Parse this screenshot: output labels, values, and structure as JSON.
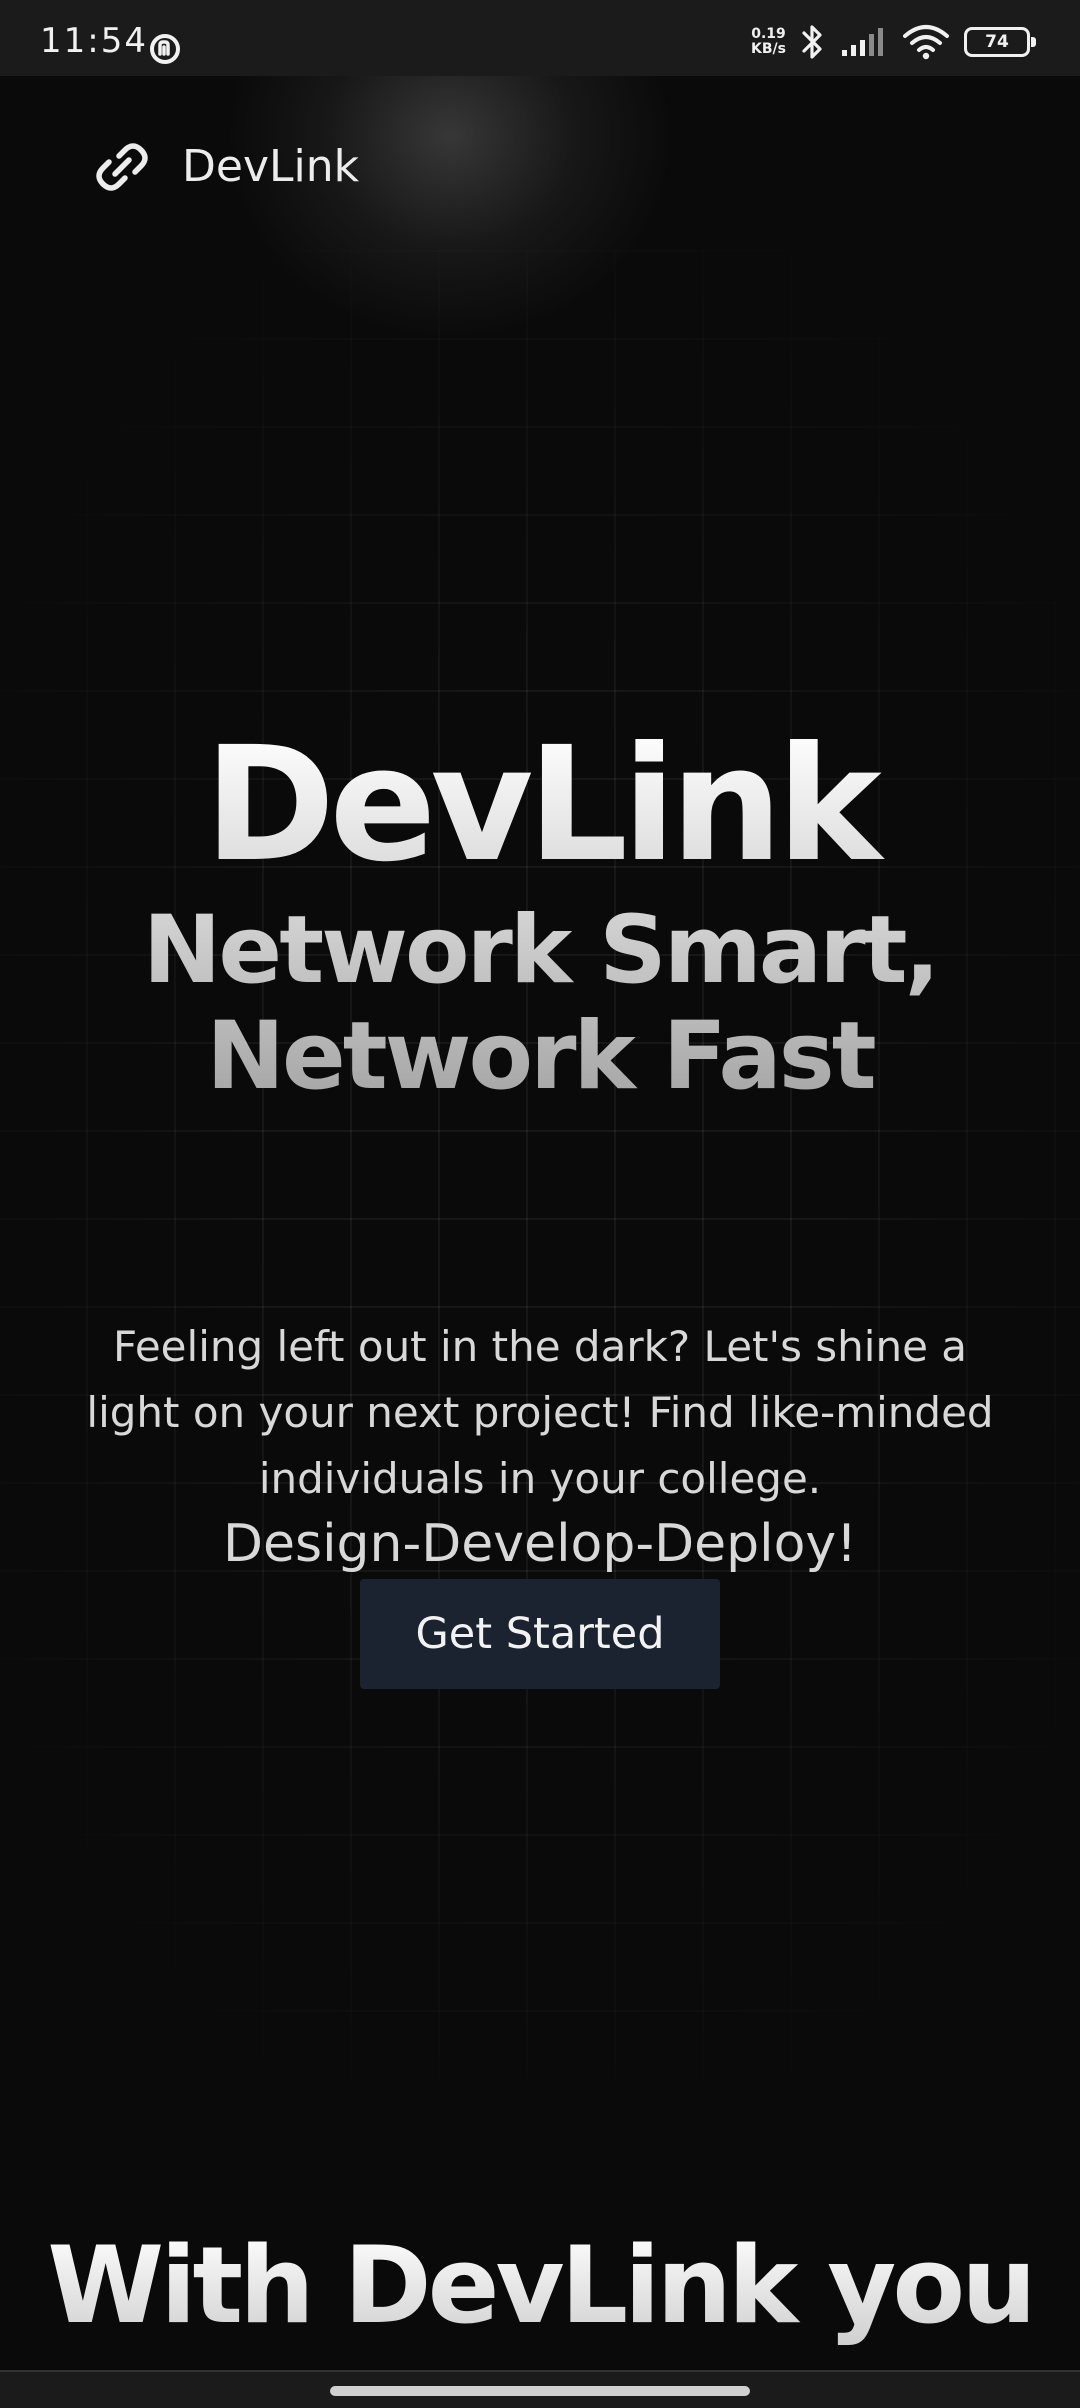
{
  "status_bar": {
    "time": "11:54",
    "net_speed_value": "0.19",
    "net_speed_unit": "KB/s",
    "battery_level": "74"
  },
  "header": {
    "brand_name": "DevLink",
    "logo_icon": "link-icon"
  },
  "hero": {
    "title": "DevLink",
    "subtitle_line1": "Network Smart,",
    "subtitle_line2": "Network Fast",
    "description_line1": "Feeling left out in the dark? Let's shine a",
    "description_line2": "light on your next project! Find like-minded",
    "description_line3": "individuals in your college.",
    "tagline": "Design-Develop-Deploy!",
    "cta_label": "Get Started"
  },
  "next_section": {
    "heading": "With DevLink you"
  },
  "colors": {
    "background": "#0a0a0a",
    "button_bg": "#1b2230",
    "text_primary": "#ececec",
    "text_secondary": "#bdbdbd"
  }
}
